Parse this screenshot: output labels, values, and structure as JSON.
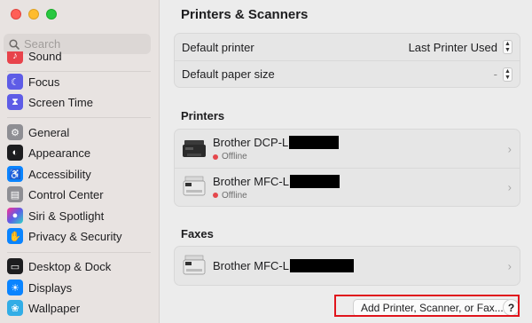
{
  "window": {
    "traffic_lights": [
      "close",
      "minimize",
      "zoom"
    ]
  },
  "sidebar": {
    "search_placeholder": "Search",
    "items": [
      {
        "label": "Sound",
        "icon": "sound-icon",
        "color": "#e8434b"
      },
      {
        "label": "Focus",
        "icon": "moon-icon",
        "color": "#5e5ce6"
      },
      {
        "label": "Screen Time",
        "icon": "hourglass-icon",
        "color": "#5e5ce6"
      },
      {
        "label": "General",
        "icon": "gear-icon",
        "color": "#8e8e93"
      },
      {
        "label": "Appearance",
        "icon": "appearance-icon",
        "color": "#1d1d1f"
      },
      {
        "label": "Accessibility",
        "icon": "accessibility-icon",
        "color": "#0a84ff"
      },
      {
        "label": "Control Center",
        "icon": "control-center-icon",
        "color": "#8e8e93"
      },
      {
        "label": "Siri & Spotlight",
        "icon": "siri-icon",
        "color": "#3a3a3c"
      },
      {
        "label": "Privacy & Security",
        "icon": "hand-icon",
        "color": "#0a84ff"
      },
      {
        "label": "Desktop & Dock",
        "icon": "dock-icon",
        "color": "#1d1d1f"
      },
      {
        "label": "Displays",
        "icon": "sun-icon",
        "color": "#0a84ff"
      },
      {
        "label": "Wallpaper",
        "icon": "wallpaper-icon",
        "color": "#32ade6"
      }
    ]
  },
  "main": {
    "title": "Printers & Scanners",
    "settings": [
      {
        "label": "Default printer",
        "value": "Last Printer Used"
      },
      {
        "label": "Default paper size",
        "value": "-"
      }
    ],
    "printers_title": "Printers",
    "printers": [
      {
        "name": "Brother DCP-L",
        "status": "Offline"
      },
      {
        "name": "Brother MFC-L",
        "status": "Offline"
      }
    ],
    "faxes_title": "Faxes",
    "faxes": [
      {
        "name": "Brother MFC-L"
      }
    ],
    "add_button": "Add Printer, Scanner, or Fax...",
    "help_button": "?"
  },
  "colors": {
    "offline_dot": "#e5484d",
    "highlight_box": "#e0141c"
  }
}
